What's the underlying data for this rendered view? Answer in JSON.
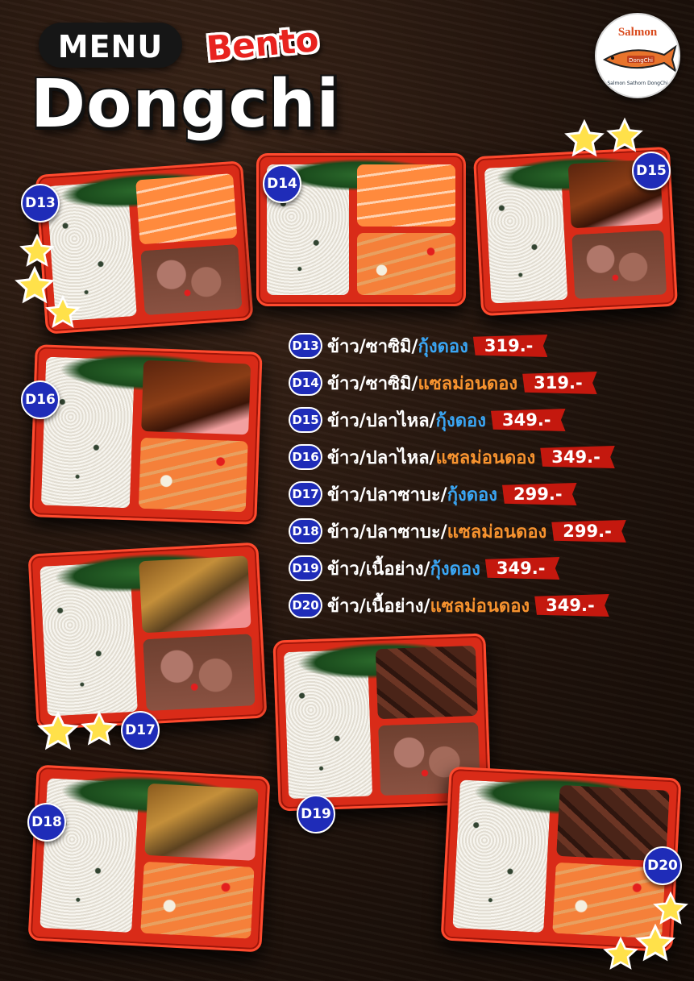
{
  "title": {
    "menu": "MENU",
    "bento": "Bento",
    "dongchi": "Dongchi"
  },
  "logo": {
    "name": "Salmon",
    "sub": "DongChi",
    "facebook": "Salmon Sathorn DongChi"
  },
  "colors": {
    "badge": "#1f2cb8",
    "price_bg": "#c4180e",
    "tray": "#d92b18",
    "accent_blue": "#3aa6f4",
    "accent_orange": "#f7932f",
    "star": "#ffe14a"
  },
  "boxes": [
    {
      "code": "D13",
      "compA": "salmon-sashimi",
      "compB": "shrimp-dong"
    },
    {
      "code": "D14",
      "compA": "salmon-sashimi",
      "compB": "salmon-dong"
    },
    {
      "code": "D15",
      "compA": "grilled-eel",
      "compB": "shrimp-dong"
    },
    {
      "code": "D16",
      "compA": "grilled-eel",
      "compB": "salmon-dong"
    },
    {
      "code": "D17",
      "compA": "grilled-saba",
      "compB": "shrimp-dong"
    },
    {
      "code": "D18",
      "compA": "grilled-saba",
      "compB": "salmon-dong"
    },
    {
      "code": "D19",
      "compA": "grilled-beef",
      "compB": "shrimp-dong"
    },
    {
      "code": "D20",
      "compA": "grilled-beef",
      "compB": "salmon-dong"
    }
  ],
  "menu_items": [
    {
      "code": "D13",
      "part1": "ข้าว/ซาซิมิ/",
      "part2": "กุ้งดอง",
      "price": "319.-"
    },
    {
      "code": "D14",
      "part1": "ข้าว/ซาซิมิ/",
      "part2": "แซลม่อนดอง",
      "price": "319.-"
    },
    {
      "code": "D15",
      "part1": "ข้าว/ปลาไหล/",
      "part2": "กุ้งดอง",
      "price": "349.-"
    },
    {
      "code": "D16",
      "part1": "ข้าว/ปลาไหล/",
      "part2": "แซลม่อนดอง",
      "price": "349.-"
    },
    {
      "code": "D17",
      "part1": "ข้าว/ปลาซาบะ/",
      "part2": "กุ้งดอง",
      "price": "299.-"
    },
    {
      "code": "D18",
      "part1": "ข้าว/ปลาซาบะ/",
      "part2": "แซลม่อนดอง",
      "price": "299.-"
    },
    {
      "code": "D19",
      "part1": "ข้าว/เนื้อย่าง/",
      "part2": "กุ้งดอง",
      "price": "349.-"
    },
    {
      "code": "D20",
      "part1": "ข้าว/เนื้อย่าง/",
      "part2": "แซลม่อนดอง",
      "price": "349.-"
    }
  ]
}
